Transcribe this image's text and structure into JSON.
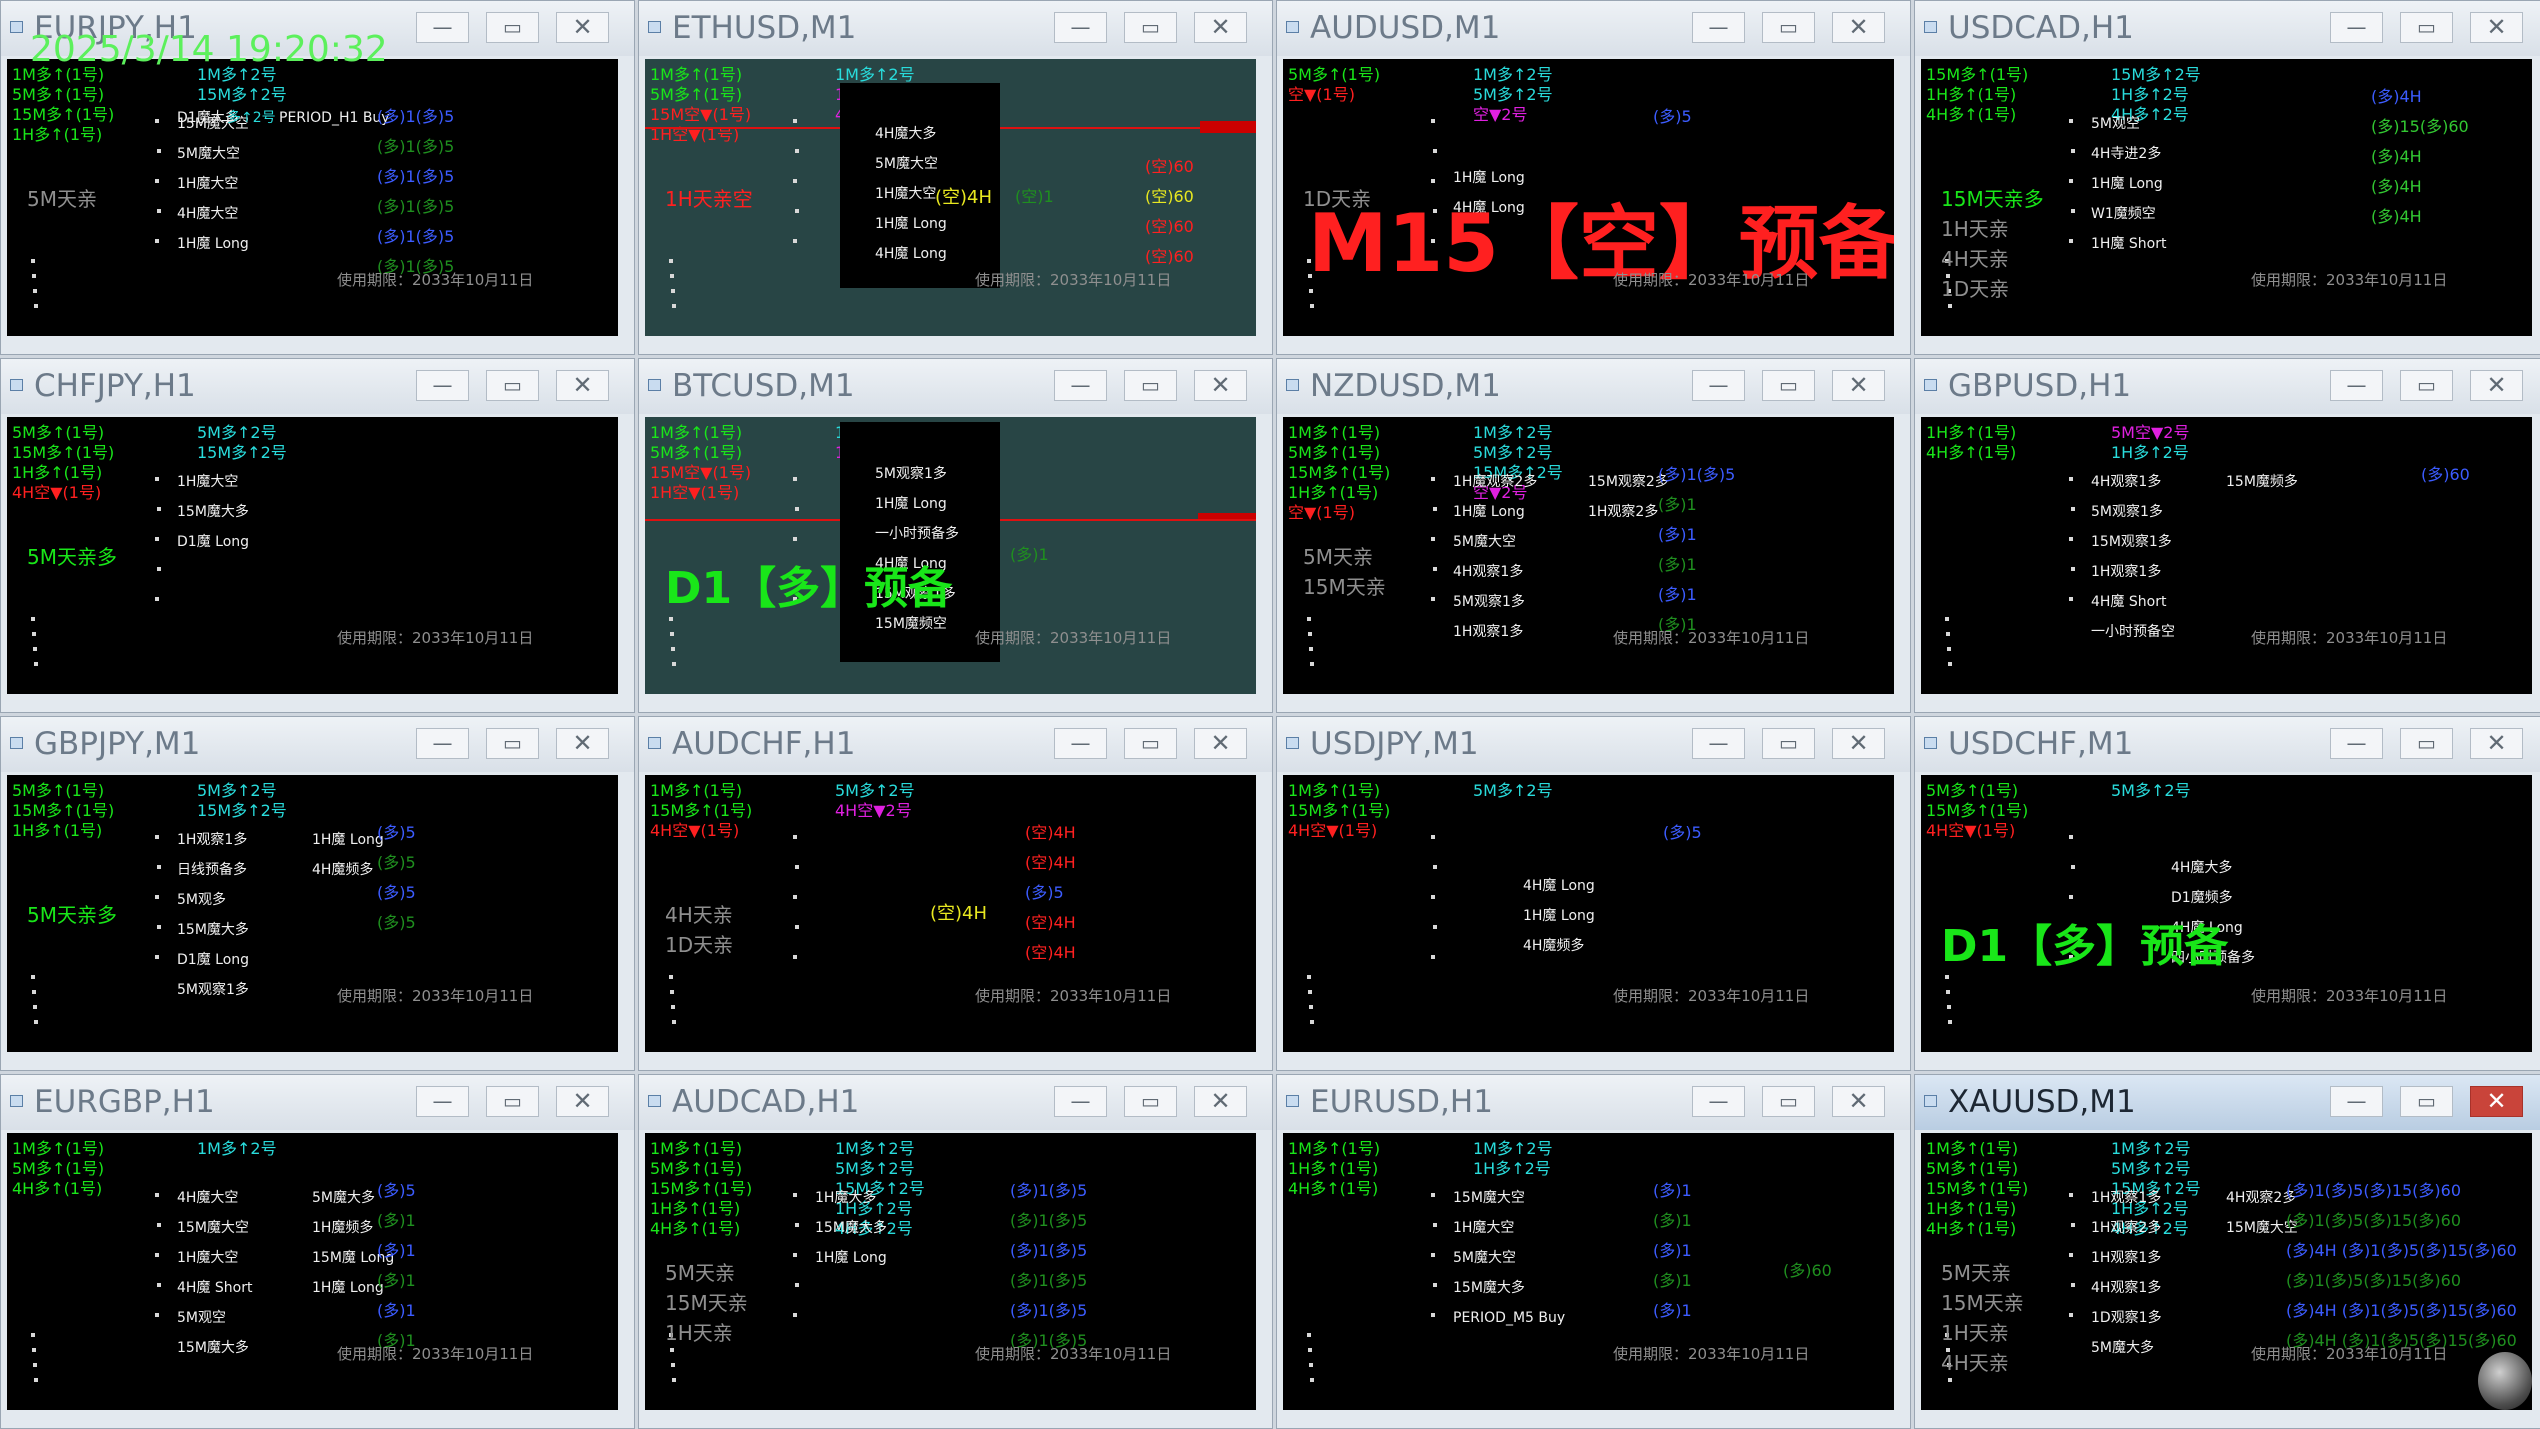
{
  "clock": "2025/3/14 19:20:32",
  "expiry": "使用期限：2033年10月11日",
  "windows": [
    {
      "title": "EURJPY,H1",
      "left": [
        "1M多↑(1号)",
        "5M多↑(1号)",
        "15M多↑(1号)",
        "1H多↑(1号)"
      ],
      "mid": [
        "1M多↑2号",
        "15M多↑2号"
      ],
      "d1": "D1魔大多",
      "d1s": "多↑2号",
      "period": "PERIOD_H1 Buy",
      "list": [
        "15M魔大空",
        "5M魔大空",
        "1H魔大空",
        "4H魔大空",
        "1H魔 Long"
      ],
      "st": "5M天亲",
      "right": [
        "(多)1(多)5",
        "(多)1(多)5",
        "(多)1(多)5",
        "(多)1(多)5",
        "(多)1(多)5",
        "(多)1(多)5"
      ]
    },
    {
      "title": "ETHUSD,M1",
      "left": [
        "1M多↑(1号)",
        "5M多↑(1号)",
        "15M空▼(1号)",
        "1H空▼(1号)"
      ],
      "mid": [
        "1M多↑2号",
        "1H空▼2号",
        "4H空▼2号"
      ],
      "list": [
        "4H魔大多",
        "5M魔大空",
        "1H魔大空",
        "1H魔 Long",
        "4H魔 Long"
      ],
      "st": "1H天亲空",
      "tag": "(空)4H",
      "pay": "(空)1",
      "right": [
        "(空)60",
        "(空)60",
        "(空)60",
        "(空)60"
      ]
    },
    {
      "title": "AUDUSD,M1",
      "left": [
        "5M多↑(1号)",
        "空▼(1号)"
      ],
      "mid": [
        "1M多↑2号",
        "5M多↑2号",
        "空▼2号"
      ],
      "list": [
        "1H魔 Long",
        "4H魔 Long"
      ],
      "st": "1D天亲",
      "big": "M15【空】预备",
      "right": [
        "(多)5"
      ]
    },
    {
      "title": "USDCAD,H1",
      "left": [
        "15M多↑(1号)",
        "1H多↑(1号)",
        "4H多↑(1号)"
      ],
      "mid": [
        "15M多↑2号",
        "1H多↑2号",
        "4H多↑2号"
      ],
      "list": [
        "5M观空",
        "4H寺进2多",
        "1H魔 Long",
        "W1魔频空",
        "1H魔 Short"
      ],
      "st": [
        "15M天亲多",
        "1H天亲",
        "4H天亲",
        "1D天亲"
      ],
      "right": [
        "(多)4H",
        "(多)15(多)60",
        "(多)4H",
        "(多)4H",
        "(多)4H"
      ]
    },
    {
      "title": "CHFJPY,H1",
      "left": [
        "5M多↑(1号)",
        "15M多↑(1号)",
        "1H多↑(1号)",
        "4H空▼(1号)"
      ],
      "mid": [
        "5M多↑2号",
        "15M多↑2号"
      ],
      "list": [
        "1H魔大空",
        "15M魔大多",
        "D1魔 Long"
      ],
      "st": "5M天亲多"
    },
    {
      "title": "BTCUSD,M1",
      "left": [
        "1M多↑(1号)",
        "5M多↑(1号)",
        "15M空▼(1号)",
        "1H空▼(1号)"
      ],
      "mid": [
        "1M多↑2号",
        "1H空▼2号"
      ],
      "list": [
        "5M观察1多",
        "1H魔 Long",
        "一小时预备多",
        "4H魔 Long",
        "15M观察1多",
        "15M魔频空"
      ],
      "big": "D1【多】预备",
      "pay": "(多)1"
    },
    {
      "title": "NZDUSD,M1",
      "left": [
        "1M多↑(1号)",
        "5M多↑(1号)",
        "15M多↑(1号)",
        "1H多↑(1号)",
        "空▼(1号)"
      ],
      "mid": [
        "1M多↑2号",
        "5M多↑2号",
        "15M多↑2号",
        "空▼2号"
      ],
      "list": [
        "1H魔观察2多",
        "1H魔 Long",
        "5M魔大空",
        "4H观察1多",
        "5M观察1多",
        "1H观察1多"
      ],
      "list2": [
        "15M观察2多",
        "1H观察2多"
      ],
      "st": [
        "5M天亲",
        "15M天亲"
      ],
      "right": [
        "(多)1(多)5",
        "(多)1",
        "(多)1",
        "(多)1",
        "(多)1",
        "(多)1"
      ]
    },
    {
      "title": "GBPUSD,H1",
      "left": [
        "1H多↑(1号)",
        "4H多↑(1号)"
      ],
      "mid": [
        "5M空▼2号",
        "1H多↑2号"
      ],
      "list": [
        "4H观察1多",
        "5M观察1多",
        "15M观察1多",
        "1H观察1多",
        "4H魔 Short",
        "一小时预备空"
      ],
      "list2": [
        "15M魔频多"
      ],
      "right": [
        "(多)60"
      ]
    },
    {
      "title": "GBPJPY,M1",
      "left": [
        "5M多↑(1号)",
        "15M多↑(1号)",
        "1H多↑(1号)"
      ],
      "mid": [
        "5M多↑2号",
        "15M多↑2号"
      ],
      "list": [
        "1H观察1多",
        "日线预备多",
        "5M观多",
        "15M魔大多",
        "D1魔 Long",
        "5M观察1多"
      ],
      "list2": [
        "1H魔 Long",
        "4H魔频多"
      ],
      "st": "5M天亲多",
      "right": [
        "(多)5",
        "(多)5",
        "(多)5",
        "(多)5"
      ]
    },
    {
      "title": "AUDCHF,H1",
      "left": [
        "1M多↑(1号)",
        "15M多↑(1号)",
        "4H空▼(1号)"
      ],
      "mid": [
        "5M多↑2号",
        "4H空▼2号"
      ],
      "st": [
        "4H天亲",
        "1D天亲"
      ],
      "tag": "(空)4H",
      "right": [
        "(空)4H",
        "(空)4H",
        "(多)5",
        "(空)4H",
        "(空)4H"
      ]
    },
    {
      "title": "USDJPY,M1",
      "left": [
        "1M多↑(1号)",
        "15M多↑(1号)",
        "4H空▼(1号)"
      ],
      "mid": [
        "5M多↑2号"
      ],
      "list": [
        "4H魔 Long",
        "1H魔 Long",
        "4H魔频多"
      ],
      "right": [
        "(多)5"
      ]
    },
    {
      "title": "USDCHF,M1",
      "left": [
        "5M多↑(1号)",
        "15M多↑(1号)",
        "4H空▼(1号)"
      ],
      "mid": [
        "5M多↑2号"
      ],
      "list": [
        "4H魔大多",
        "D1魔频多",
        "4H魔 Long",
        "四小时预备多"
      ],
      "big": "D1【多】预备"
    },
    {
      "title": "EURGBP,H1",
      "left": [
        "1M多↑(1号)",
        "5M多↑(1号)",
        "4H多↑(1号)"
      ],
      "mid": [
        "1M多↑2号"
      ],
      "list": [
        "4H魔大空",
        "15M魔大空",
        "1H魔大空",
        "4H魔 Short",
        "5M观空",
        "15M魔大多"
      ],
      "list2": [
        "5M魔大多",
        "1H魔频多",
        "15M魔 Long",
        "1H魔 Long"
      ],
      "right": [
        "(多)5",
        "(多)1",
        "(多)1",
        "(多)1",
        "(多)1",
        "(多)1"
      ]
    },
    {
      "title": "AUDCAD,H1",
      "left": [
        "1M多↑(1号)",
        "5M多↑(1号)",
        "15M多↑(1号)",
        "1H多↑(1号)",
        "4H多↑(1号)"
      ],
      "mid": [
        "1M多↑2号",
        "5M多↑2号",
        "15M多↑2号",
        "1H多↑2号",
        "4H多↑2号"
      ],
      "list": [
        "1H魔大多",
        "15M魔大多",
        "1H魔 Long"
      ],
      "st": [
        "5M天亲",
        "15M天亲",
        "1H天亲"
      ],
      "right": [
        "(多)1(多)5",
        "(多)1(多)5",
        "(多)1(多)5",
        "(多)1(多)5",
        "(多)1(多)5",
        "(多)1(多)5"
      ]
    },
    {
      "title": "EURUSD,H1",
      "left": [
        "1M多↑(1号)",
        "1H多↑(1号)",
        "4H多↑(1号)"
      ],
      "mid": [
        "1M多↑2号",
        "1H多↑2号"
      ],
      "list": [
        "15M魔大空",
        "1H魔大空",
        "5M魔大空",
        "15M魔大多",
        "PERIOD_M5 Buy"
      ],
      "right": [
        "(多)1",
        "(多)1",
        "(多)1",
        "(多)1",
        "(多)1"
      ],
      "pay": "(多)60"
    },
    {
      "title": "XAUUSD,M1",
      "left": [
        "1M多↑(1号)",
        "5M多↑(1号)",
        "15M多↑(1号)",
        "1H多↑(1号)",
        "4H多↑(1号)"
      ],
      "mid": [
        "1M多↑2号",
        "5M多↑2号",
        "15M多↑2号",
        "1H多↑2号",
        "4H多↑2号"
      ],
      "list": [
        "1H观察1多",
        "1H观察2多",
        "1H观察1多",
        "4H观察1多",
        "1D观察1多",
        "5M魔大多"
      ],
      "list2": [
        "4H观察2多",
        "15M魔大空"
      ],
      "st": [
        "5M天亲",
        "15M天亲",
        "1H天亲",
        "4H天亲"
      ],
      "right": [
        "(多)1(多)5(多)15(多)60",
        "(多)1(多)5(多)15(多)60",
        "(多)4H (多)1(多)5(多)15(多)60",
        "(多)1(多)5(多)15(多)60",
        "(多)4H (多)1(多)5(多)15(多)60",
        "(多)4H (多)1(多)5(多)15(多)60"
      ]
    }
  ]
}
